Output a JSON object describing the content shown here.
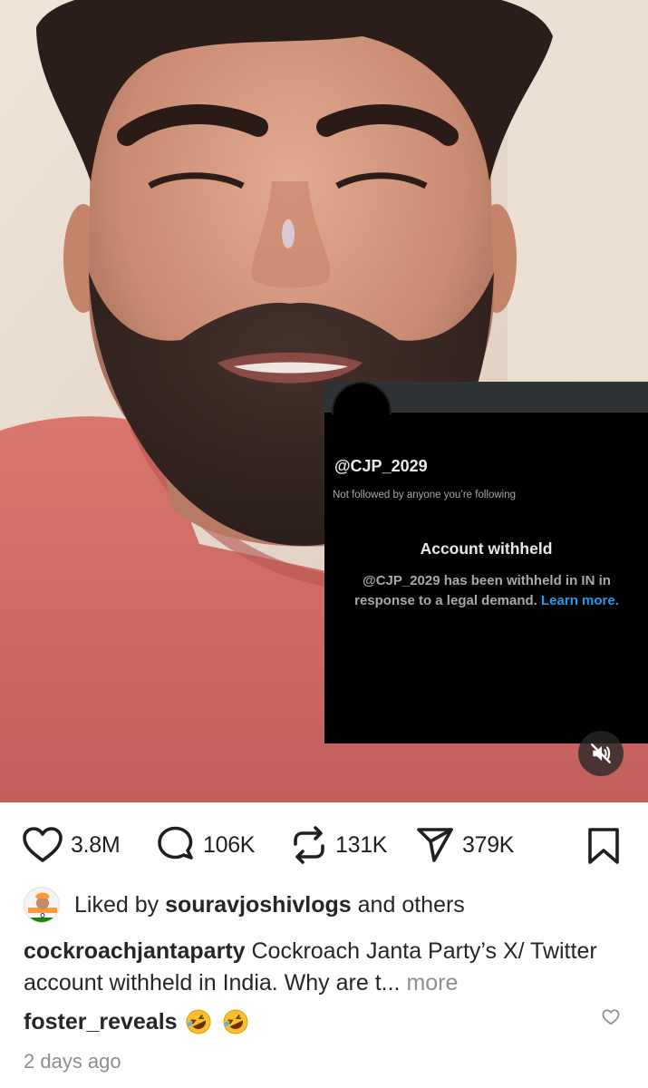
{
  "overlay": {
    "handle": "@CJP_2029",
    "not_followed": "Not followed by anyone you’re following",
    "withheld_title": "Account withheld",
    "withheld_body": "@CJP_2029 has been withheld in IN in response to a legal demand.",
    "learn_more": "Learn more."
  },
  "video": {
    "muted": true,
    "mute_icon": "speaker-muted-icon"
  },
  "actions": {
    "likes": "3.8M",
    "comments": "106K",
    "reposts": "131K",
    "shares": "379K",
    "icons": [
      "heart-icon",
      "comment-icon",
      "repost-icon",
      "share-icon",
      "bookmark-icon"
    ]
  },
  "liked_by": {
    "prefix": "Liked by",
    "user": "souravjoshivlogs",
    "suffix": "and others"
  },
  "caption": {
    "username": "cockroachjantaparty",
    "text": "Cockroach Janta Party’s X/ Twitter account withheld in India. Why are t...",
    "more": "more"
  },
  "comment": {
    "username": "foster_reveals",
    "emoji": "🤣🤣"
  },
  "timestamp": "2 days ago",
  "colors": {
    "link_blue": "#1d9bf0",
    "muted_gray": "#8e8e8e",
    "text": "#262626"
  }
}
